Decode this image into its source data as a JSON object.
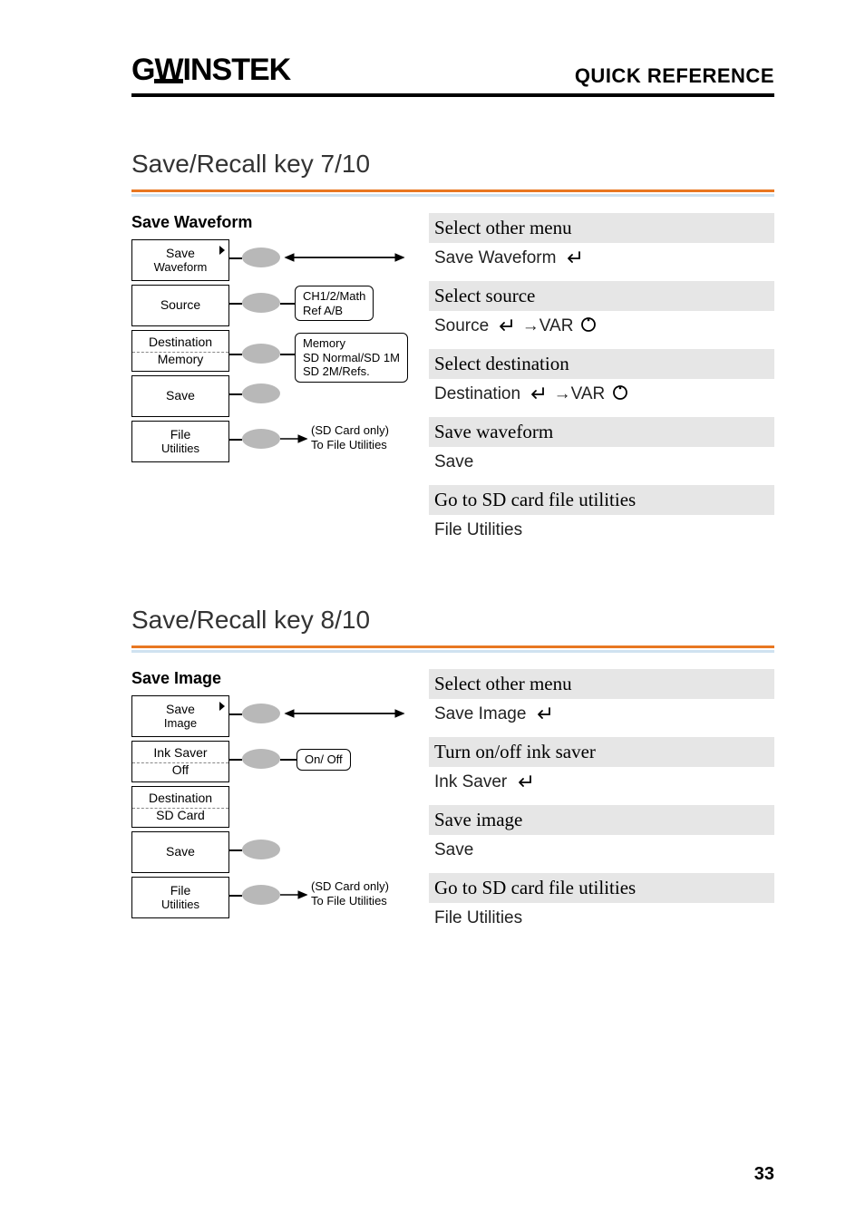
{
  "header": {
    "logo": "GWINSTEK",
    "title": "QUICK REFERENCE"
  },
  "page_number": "33",
  "sec7": {
    "title": "Save/Recall key 7/10",
    "dia_title": "Save Waveform",
    "menu": {
      "b1_l1": "Save",
      "b1_l2": "Waveform",
      "b2": "Source",
      "b3_top": "Destination",
      "b3_bot": "Memory",
      "b4": "Save",
      "b5_l1": "File",
      "b5_l2": "Utilities"
    },
    "side": {
      "box1_l1": "CH1/2/Math",
      "box1_l2": "Ref A/B",
      "box2_l1": "Memory",
      "box2_l2": "SD Normal/SD 1M",
      "box2_l3": "SD 2M/Refs.",
      "txt_l1": "(SD Card only)",
      "txt_l2": "To File Utilities"
    },
    "steps": {
      "h1": "Select other menu",
      "s1": "Save Waveform",
      "h2": "Select source",
      "s2a": "Source",
      "s2b": "→VAR",
      "h3": "Select destination",
      "s3a": "Destination",
      "s3b": "→VAR",
      "h4": "Save waveform",
      "s4": "Save",
      "h5": "Go to SD card file utilities",
      "s5": "File Utilities"
    }
  },
  "sec8": {
    "title": "Save/Recall key 8/10",
    "dia_title": "Save Image",
    "menu": {
      "b1_l1": "Save",
      "b1_l2": "Image",
      "b2_top": "Ink Saver",
      "b2_bot": "Off",
      "b3_top": "Destination",
      "b3_bot": "SD Card",
      "b4": "Save",
      "b5_l1": "File",
      "b5_l2": "Utilities"
    },
    "side": {
      "box1": "On/ Off",
      "txt_l1": "(SD Card only)",
      "txt_l2": "To File Utilities"
    },
    "steps": {
      "h1": "Select other menu",
      "s1": "Save Image",
      "h2": "Turn on/off ink saver",
      "s2": "Ink Saver",
      "h3": "Save image",
      "s3": "Save",
      "h4": "Go to SD card file utilities",
      "s4": "File Utilities"
    }
  }
}
